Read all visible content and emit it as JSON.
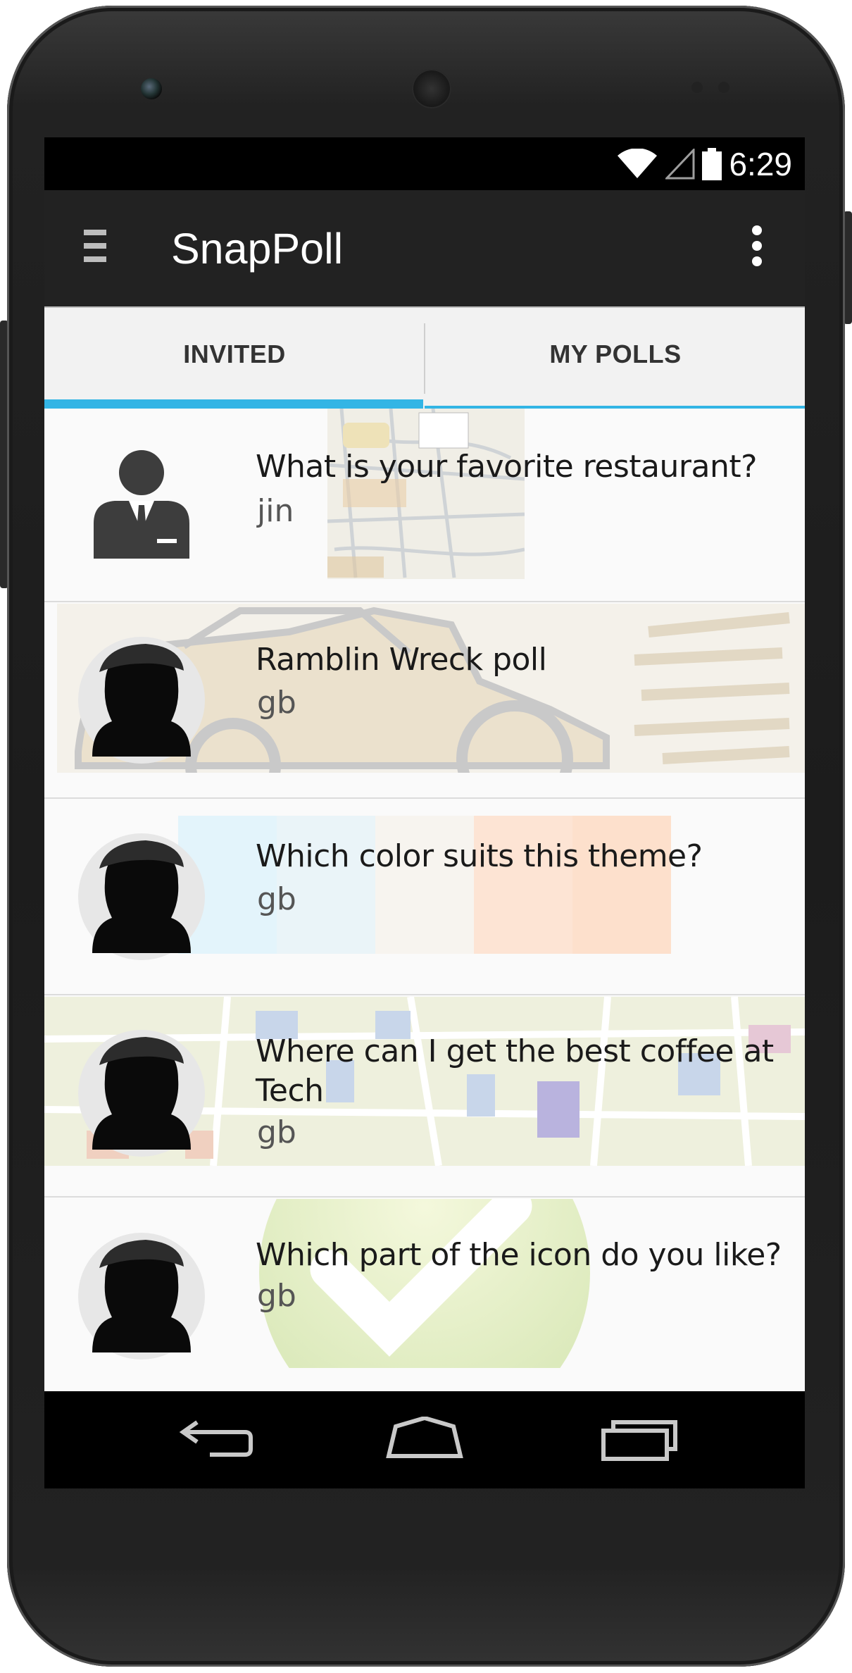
{
  "device": {
    "camera_icon": "front-camera",
    "speaker_icon": "earpiece-speaker"
  },
  "status_bar": {
    "time": "6:29",
    "icons": [
      "wifi-icon",
      "signal-icon",
      "battery-icon"
    ]
  },
  "action_bar": {
    "menu_icon": "hamburger-menu-icon",
    "title": "SnapPoll",
    "overflow_icon": "overflow-menu-icon",
    "background_color": "#222222"
  },
  "tabs": [
    {
      "label": "INVITED",
      "selected": true
    },
    {
      "label": "MY POLLS",
      "selected": false
    }
  ],
  "accent_color": "#33b5e5",
  "polls": [
    {
      "question": "What is your favorite restaurant?",
      "author": "jin",
      "avatar": "businessman-avatar-icon",
      "background": "street-map"
    },
    {
      "question": "Ramblin Wreck poll",
      "author": "gb",
      "avatar": "person-silhouette-icon",
      "background": "ramblin-wreck-car"
    },
    {
      "question": "Which color suits this theme?",
      "author": "gb",
      "avatar": "person-silhouette-icon",
      "background": "color-swatches"
    },
    {
      "question": "Where can I get the best coffee at Tech",
      "author": "gb",
      "avatar": "person-silhouette-icon",
      "background": "campus-map"
    },
    {
      "question": "Which part of the icon do you like?",
      "author": "gb",
      "avatar": "person-silhouette-icon",
      "background": "checkmark-logo"
    }
  ],
  "nav_bar": {
    "buttons": [
      "back-icon",
      "home-icon",
      "recent-apps-icon"
    ]
  }
}
